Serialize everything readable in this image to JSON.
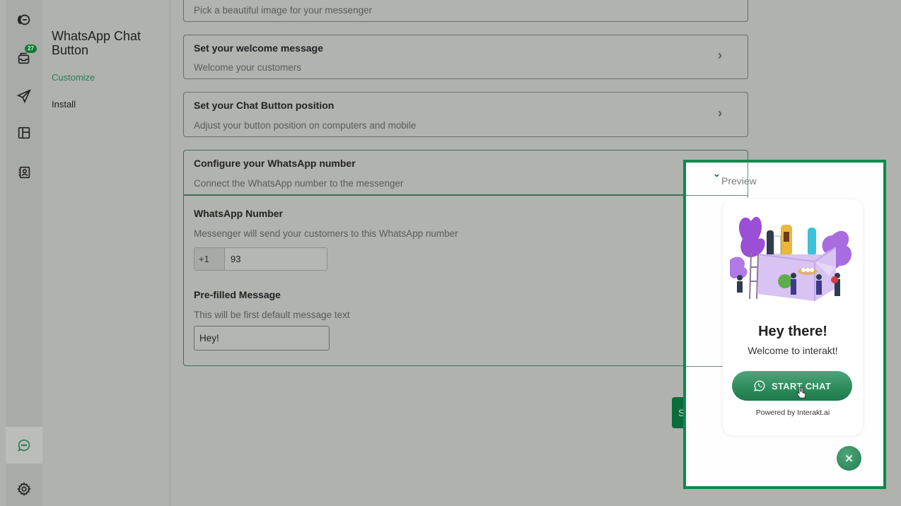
{
  "rail": {
    "items": [
      {
        "icon": "conversations-icon"
      },
      {
        "icon": "inbox-icon",
        "badge": "27"
      },
      {
        "icon": "campaign-send-icon"
      },
      {
        "icon": "layout-icon"
      },
      {
        "icon": "contacts-icon"
      },
      {
        "icon": "chat-widget-icon",
        "active": true
      },
      {
        "icon": "settings-icon"
      }
    ]
  },
  "subnav": {
    "title": "WhatsApp Chat Button",
    "links": [
      {
        "label": "Customize",
        "active": true
      },
      {
        "label": "Install",
        "active": false
      }
    ]
  },
  "sections": [
    {
      "title": "",
      "subtitle": "Pick a beautiful image for your messenger",
      "state": "collapsed"
    },
    {
      "title": "Set your welcome message",
      "subtitle": "Welcome your customers",
      "state": "collapsed"
    },
    {
      "title": "Set your Chat Button position",
      "subtitle": "Adjust your button position on computers and mobile",
      "state": "collapsed"
    },
    {
      "title": "Configure your WhatsApp number",
      "subtitle": "Connect the WhatsApp number to the messenger",
      "state": "expanded"
    }
  ],
  "whatsapp_config": {
    "number_label": "WhatsApp Number",
    "number_help": "Messenger will send your customers to this WhatsApp number",
    "country_code": "+1",
    "number_value": "93",
    "message_label": "Pre-filled Message",
    "message_help": "This will be first default message text",
    "message_value": "Hey!"
  },
  "save_button": {
    "label": "Save Changes"
  },
  "preview": {
    "label": "Preview",
    "widget_title": "Hey there!",
    "widget_subtitle": "Welcome to interakt!",
    "start_chat_label": "START CHAT",
    "powered_by": "Powered by Interakt.ai",
    "close_symbol": "✕"
  },
  "colors": {
    "accent": "#0b8a4d",
    "accent_dark": "#0a6b3b",
    "link_active": "#2d7a55"
  }
}
